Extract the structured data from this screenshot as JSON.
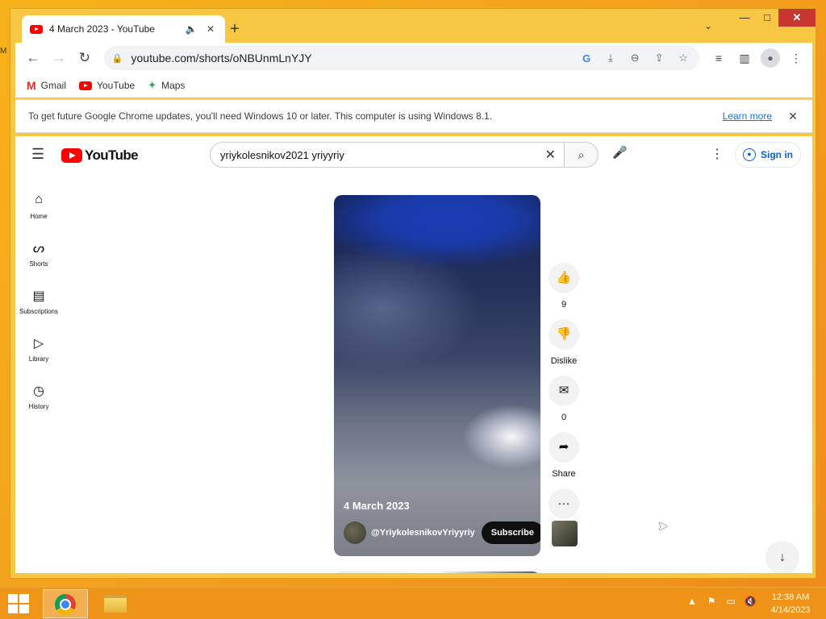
{
  "desktop": {
    "edge_text": "M"
  },
  "browser": {
    "tab": {
      "title": "4 March 2023 - YouTube",
      "audio_icon": "🔈",
      "close_icon": "✕"
    },
    "new_tab_icon": "+",
    "tab_search_icon": "⌄",
    "window_controls": {
      "minimize": "—",
      "maximize": "□",
      "close": "✕"
    },
    "toolbar": {
      "back": "←",
      "forward": "→",
      "reload": "↻",
      "lock_icon": "🔒",
      "url": "youtube.com/shorts/oNBUnmLnYJY",
      "omnibox_icons": [
        "G",
        "⤓",
        "⊖",
        "⇪",
        "☆"
      ],
      "right_icons": [
        "≡",
        "▥"
      ],
      "profile_icon": "●",
      "menu_icon": "⋮"
    },
    "bookmarks": [
      {
        "label": "Gmail",
        "icon": "M"
      },
      {
        "label": "YouTube",
        "icon": "yt"
      },
      {
        "label": "Maps",
        "icon": "✦"
      }
    ],
    "infobar": {
      "message": "To get future Google Chrome updates, you'll need Windows 10 or later. This computer is using Windows 8.1.",
      "link": "Learn more",
      "close_icon": "✕"
    }
  },
  "youtube": {
    "logo_text": "YouTube",
    "hamburger_icon": "☰",
    "search": {
      "value": "yriykolesnikov2021 yriyyriy",
      "clear_icon": "✕",
      "button_icon": "⌕"
    },
    "mic_icon": "🎤",
    "more_icon": "⋮",
    "signin": {
      "label": "Sign in",
      "icon": "👤"
    },
    "guide": [
      {
        "label": "Home",
        "icon": "⌂"
      },
      {
        "label": "Shorts",
        "icon": "ᔕ"
      },
      {
        "label": "Subscriptions",
        "icon": "▤"
      },
      {
        "label": "Library",
        "icon": "▷"
      },
      {
        "label": "History",
        "icon": "◷"
      }
    ],
    "short": {
      "date_title": "4 March 2023",
      "channel": "@YriykolesnikovYriyyriy",
      "subscribe": "Subscribe"
    },
    "actions": {
      "like": {
        "icon": "👍",
        "label": "9"
      },
      "dislike": {
        "icon": "👎",
        "label": "Dislike"
      },
      "comment": {
        "icon": "✉",
        "label": "0"
      },
      "share": {
        "icon": "➦",
        "label": "Share"
      },
      "more": {
        "icon": "···"
      }
    },
    "scroll_down_icon": "↓"
  },
  "taskbar": {
    "tray_icons": [
      "▲",
      "⚑",
      "▭",
      "🔇"
    ],
    "time": "12:38 AM",
    "date": "4/14/2023"
  }
}
